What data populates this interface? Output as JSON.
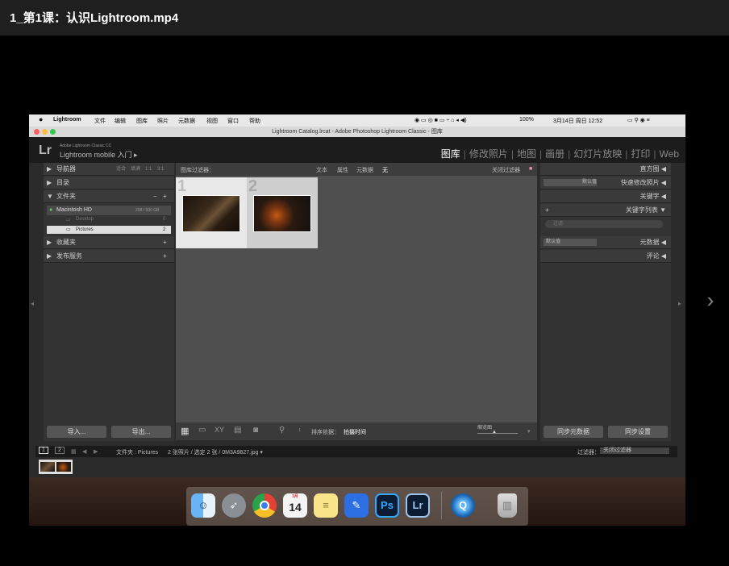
{
  "player": {
    "title": "1_第1课：认识Lightroom.mp4"
  },
  "mac_menubar": {
    "app": "Lightroom",
    "menus": [
      "文件",
      "编辑",
      "图库",
      "照片",
      "元数据",
      "视图",
      "窗口",
      "帮助"
    ],
    "battery": "100%",
    "datetime": "3月14日 周日 12:52"
  },
  "window_title": "Lightroom Catalog.lrcat - Adobe Photoshop Lightroom Classic - 图库",
  "lr_header": {
    "logo": "Lr",
    "product": "Adobe Lightroom Classic CC",
    "mobile": "Lightroom mobile 入门 ▸",
    "modules": [
      "图库",
      "修改照片",
      "地图",
      "画册",
      "幻灯片放映",
      "打印",
      "Web"
    ],
    "active_module": "图库"
  },
  "left_panel": {
    "navigator": "导航器",
    "nav_options": [
      "适合",
      "填满",
      "1:1",
      "3:1"
    ],
    "catalog": "目录",
    "folders": "文件夹",
    "volume": "Macintosh HD",
    "volume_size": "208 / 500 GB",
    "folder_items": [
      {
        "name": "Desktop",
        "count": "0"
      },
      {
        "name": "Pictures",
        "count": "2"
      }
    ],
    "collections": "收藏夹",
    "publish": "发布服务",
    "import_btn": "导入...",
    "export_btn": "导出..."
  },
  "filter_bar": {
    "title": "图库过滤器：",
    "options": [
      "文本",
      "属性",
      "元数据",
      "无"
    ],
    "close": "关闭过滤器"
  },
  "grid": {
    "cells": [
      {
        "number": "1",
        "selected": true
      },
      {
        "number": "2",
        "selected": false
      }
    ]
  },
  "toolbar": {
    "sort_label": "排序依据：",
    "sort_value": "拍摄时间",
    "thumb_label": "缩览图"
  },
  "right_panel": {
    "histogram": "直方图",
    "quick_develop": "快速修改照片",
    "preset_default": "默认值",
    "keywords": "关键字",
    "keyword_list": "关键字列表",
    "search_placeholder": "过滤",
    "metadata": "元数据",
    "comments": "评论",
    "sync_meta_btn": "同步元数据",
    "sync_settings_btn": "同步设置"
  },
  "filmstrip_bar": {
    "pages": [
      "1",
      "2"
    ],
    "path": "文件夹 : Pictures",
    "info": "2 张照片 / 选定 2 张 / 0M3A9827.jpg ▾",
    "filter_label": "过滤器：",
    "filter_value": "关闭过滤器"
  },
  "dock": {
    "calendar_day": "14",
    "calendar_month": "3月",
    "apps": [
      "finder-icon",
      "launchpad-icon",
      "chrome-icon",
      "calendar-icon",
      "notes-icon",
      "pages-icon",
      "Ps",
      "Lr",
      "quicktime-icon",
      "trash-icon"
    ]
  }
}
